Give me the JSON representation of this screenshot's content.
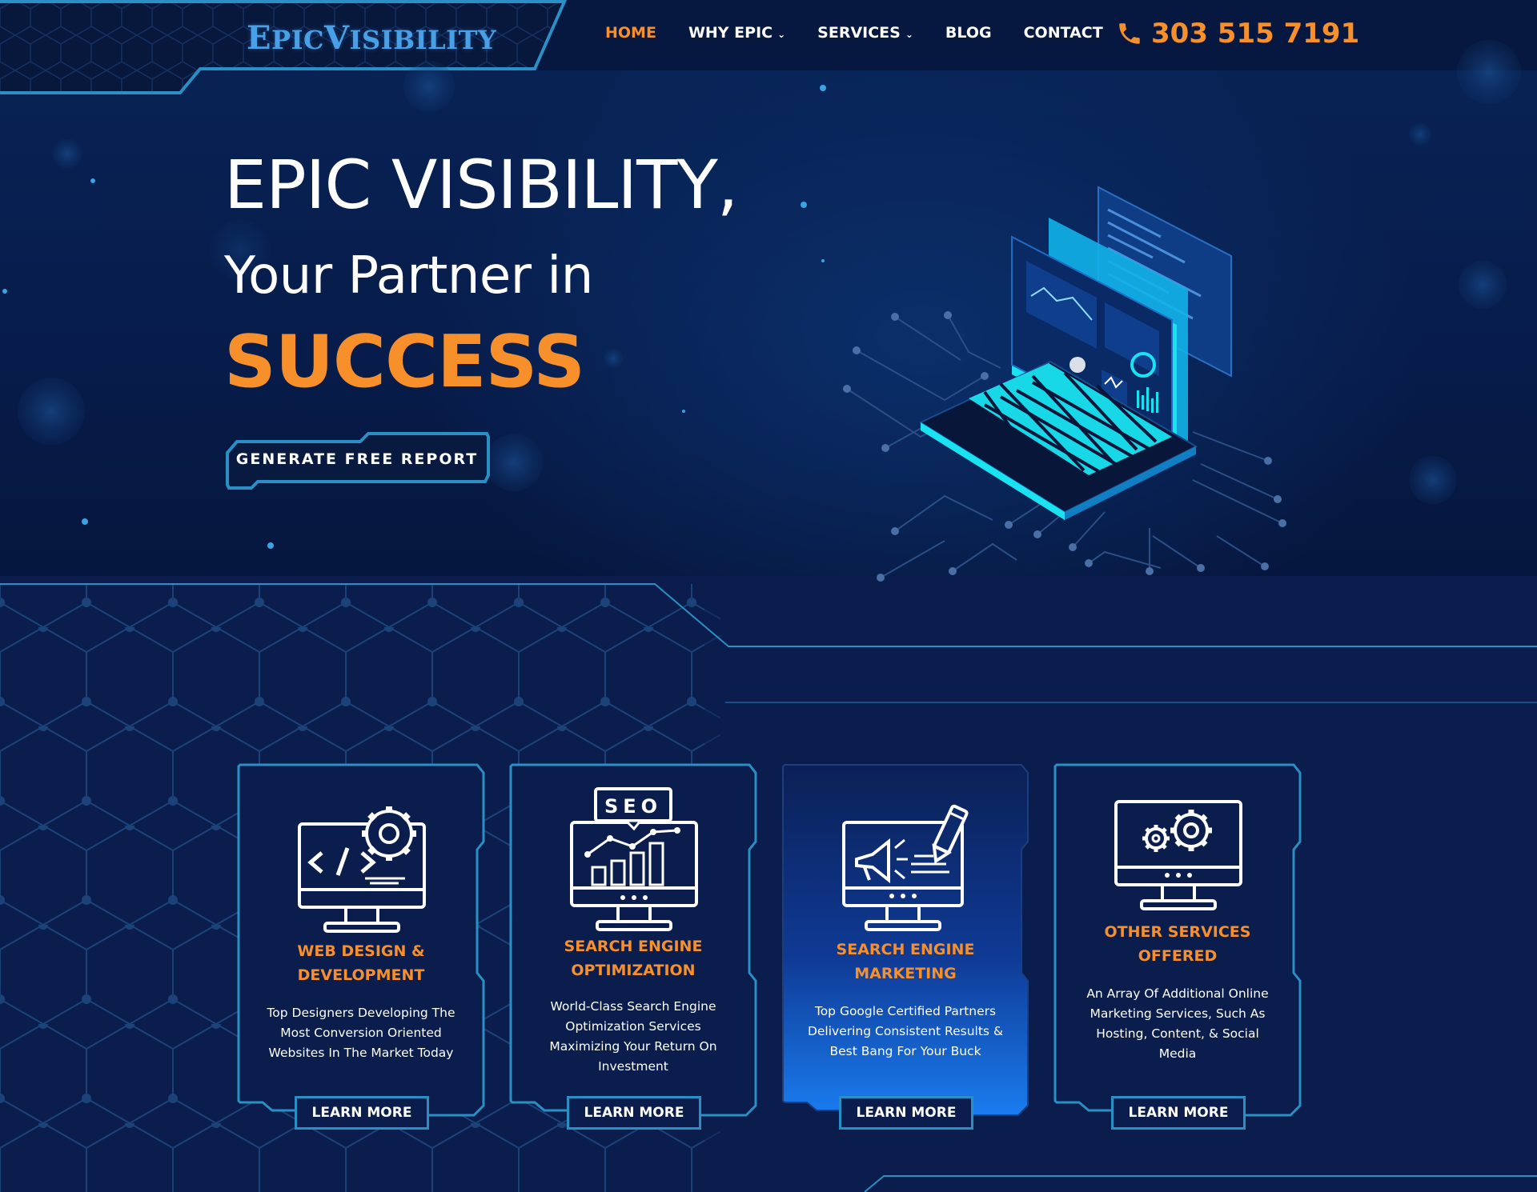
{
  "brand": {
    "logo_text_a": "E",
    "logo_text_b": "PIC",
    "logo_text_c": "V",
    "logo_text_d": "ISIBILITY"
  },
  "nav": {
    "items": [
      {
        "label": "HOME",
        "active": true,
        "dropdown": false
      },
      {
        "label": "WHY EPIC",
        "active": false,
        "dropdown": true
      },
      {
        "label": "SERVICES",
        "active": false,
        "dropdown": true
      },
      {
        "label": "BLOG",
        "active": false,
        "dropdown": false
      },
      {
        "label": "CONTACT",
        "active": false,
        "dropdown": false
      }
    ],
    "phone": "303 515 7191"
  },
  "hero": {
    "line1": "EPIC VISIBILITY,",
    "line2": "Your Partner in",
    "line3": "SUCCESS",
    "cta_label": "GENERATE FREE REPORT"
  },
  "cards": [
    {
      "icon": "web-design-icon",
      "title_1": "WEB DESIGN &",
      "title_2": "DEVELOPMENT",
      "desc": [
        "Top Designers Developing The",
        "Most Conversion Oriented",
        "Websites In The Market Today"
      ],
      "button": "LEARN MORE"
    },
    {
      "icon": "seo-icon",
      "seo_label": "SEO",
      "title_1": "SEARCH ENGINE",
      "title_2": "OPTIMIZATION",
      "desc": [
        "World-Class Search Engine",
        "Optimization Services",
        "Maximizing Your Return On",
        "Investment"
      ],
      "button": "LEARN MORE"
    },
    {
      "icon": "marketing-icon",
      "title_1": "SEARCH ENGINE",
      "title_2": "MARKETING",
      "desc": [
        "Top Google Certified Partners",
        "Delivering Consistent Results &",
        "Best Bang For Your Buck"
      ],
      "button": "LEARN MORE"
    },
    {
      "icon": "other-services-icon",
      "title_1": "OTHER SERVICES",
      "title_2": "OFFERED",
      "desc": [
        "An Array Of Additional Online",
        "Marketing Services, Such As",
        "Hosting, Content, & Social",
        "Media"
      ],
      "button": "LEARN MORE"
    }
  ],
  "colors": {
    "accent": "#f7902b",
    "frame": "#2a8fc4",
    "cyan": "#19e3f0",
    "bg": "#07173f"
  }
}
